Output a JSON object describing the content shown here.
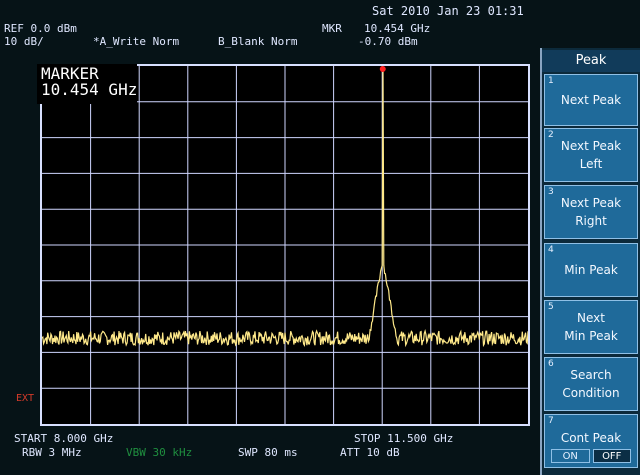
{
  "header": {
    "datetime": "Sat 2010 Jan 23 01:31",
    "ref_level": "REF 0.0 dBm",
    "scale": "10 dB/",
    "trace_a": "*A_Write Norm",
    "trace_b": "B_Blank Norm",
    "marker_label": "MKR",
    "marker_freq": "10.454 GHz",
    "marker_amp": "-0.70 dBm"
  },
  "marker_box": {
    "line1": "MARKER",
    "line2": "10.454 GHz"
  },
  "footer": {
    "start": "START 8.000 GHz",
    "stop": "STOP 11.500 GHz",
    "rbw": "RBW 3 MHz",
    "vbw": "VBW 30 kHz",
    "sweep": "SWP 80 ms",
    "atten": "ATT 10 dB"
  },
  "ext_label": "EXT",
  "softkeys": {
    "title": "Peak",
    "keys": [
      {
        "num": "1",
        "label": "Next Peak"
      },
      {
        "num": "2",
        "label": "Next Peak\nLeft"
      },
      {
        "num": "3",
        "label": "Next Peak\nRight"
      },
      {
        "num": "4",
        "label": "Min Peak"
      },
      {
        "num": "5",
        "label": "Next\nMin Peak"
      },
      {
        "num": "6",
        "label": "Search\nCondition"
      },
      {
        "num": "7",
        "label": "Cont Peak"
      }
    ],
    "toggle_on": "ON",
    "toggle_off": "OFF"
  },
  "trace": {
    "start_ghz": 8.0,
    "stop_ghz": 11.5,
    "ref_dbm": 0.0,
    "db_per_div": 10,
    "noise_floor_dbm": -76.0,
    "peak_freq_ghz": 10.454,
    "peak_dbm": -0.7,
    "color": "#ffe98a",
    "marker_color": "#ff2020",
    "grid_color": "#cfd6ff"
  }
}
